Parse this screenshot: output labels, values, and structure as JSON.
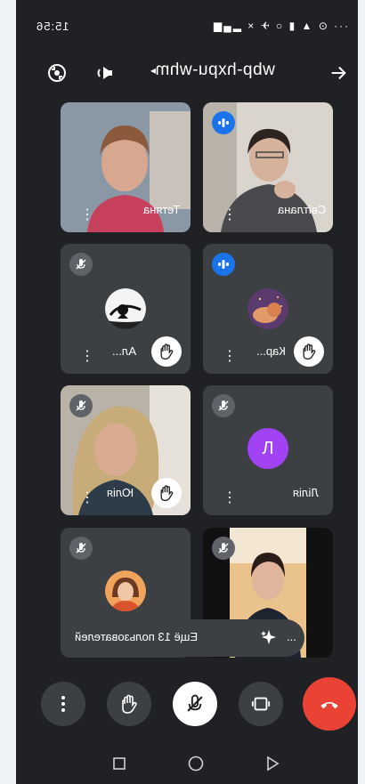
{
  "status_bar": {
    "time": "15:56",
    "icons_text": "··· ⊙ ▲ ▮ ○ ✈ × ▂▄▆"
  },
  "top_bar": {
    "meeting_code": "wbp-hxpu-whm",
    "caret": "▸",
    "icons": [
      "switch-camera-icon",
      "speaker-icon",
      "back-arrow-icon"
    ]
  },
  "participants": [
    {
      "name": "Світлана",
      "video": true,
      "speaking": true,
      "muted": false,
      "hand_raised": false
    },
    {
      "name": "Тетяна",
      "video": true,
      "speaking": false,
      "muted": false,
      "hand_raised": false
    },
    {
      "name": "Кар...",
      "video": false,
      "speaking": true,
      "muted": false,
      "hand_raised": true
    },
    {
      "name": "Ал...",
      "video": false,
      "speaking": false,
      "muted": true,
      "hand_raised": true
    },
    {
      "name": "Лілія",
      "video": false,
      "speaking": false,
      "muted": true,
      "hand_raised": false,
      "initial": "Л"
    },
    {
      "name": "Юлія",
      "video": true,
      "speaking": false,
      "muted": true,
      "hand_raised": true
    },
    {
      "name": "",
      "video": true,
      "speaking": false,
      "muted": true,
      "hand_raised": false
    },
    {
      "name": "",
      "video": false,
      "speaking": false,
      "muted": true,
      "hand_raised": false
    }
  ],
  "more_users": {
    "label": "Ещё 13 пользователей",
    "tail": "..."
  },
  "controls": [
    "more-options-icon",
    "raise-hand-icon",
    "mic-off-icon",
    "screen-share-icon",
    "end-call-icon"
  ],
  "colors": {
    "background": "#202124",
    "tile": "#3c4043",
    "speaking_badge": "#1a73e8",
    "end_call": "#ea4335",
    "letter_avatar": "#a142f4"
  }
}
